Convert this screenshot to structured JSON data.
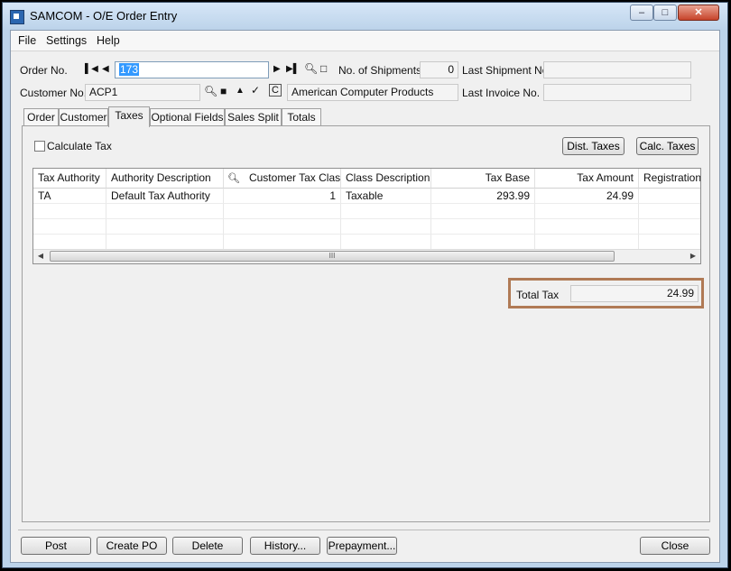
{
  "window": {
    "title": "SAMCOM - O/E Order Entry",
    "controls": {
      "min": "–",
      "max": "□",
      "close": "✕"
    }
  },
  "menu": [
    "File",
    "Settings",
    "Help"
  ],
  "header": {
    "order_no_label": "Order No.",
    "order_no_value": "173",
    "shipments_label": "No. of Shipments",
    "shipments_value": "0",
    "last_shipment_label": "Last Shipment No.",
    "last_shipment_value": "",
    "customer_no_label": "Customer No.",
    "customer_no_value": "ACP1",
    "customer_name": "American Computer Products",
    "last_invoice_label": "Last Invoice No.",
    "last_invoice_value": ""
  },
  "tabs": [
    "Order",
    "Customer",
    "Taxes",
    "Optional Fields",
    "Sales Split",
    "Totals"
  ],
  "active_tab": "Taxes",
  "taxes": {
    "calculate_tax_label": "Calculate Tax",
    "calculate_tax_checked": false,
    "dist_taxes_button": "Dist. Taxes",
    "calc_taxes_button": "Calc. Taxes",
    "columns": [
      "Tax Authority",
      "Authority Description",
      "Customer Tax Class",
      "Class Description",
      "Tax Base",
      "Tax Amount",
      "Registration I"
    ],
    "rows": [
      {
        "tax_authority": "TA",
        "authority_description": "Default Tax Authority",
        "customer_tax_class": "1",
        "class_description": "Taxable",
        "tax_base": "293.99",
        "tax_amount": "24.99",
        "registration": ""
      }
    ],
    "scroll_grip": "III",
    "total_tax_label": "Total Tax",
    "total_tax_value": "24.99"
  },
  "buttons": {
    "post": "Post",
    "create_po": "Create PO",
    "delete": "Delete",
    "history": "History...",
    "prepayment": "Prepayment...",
    "close": "Close"
  },
  "colors": {
    "highlight": "#b07a55",
    "selection": "#3399ff",
    "window_frame": "#bcd3ea"
  }
}
